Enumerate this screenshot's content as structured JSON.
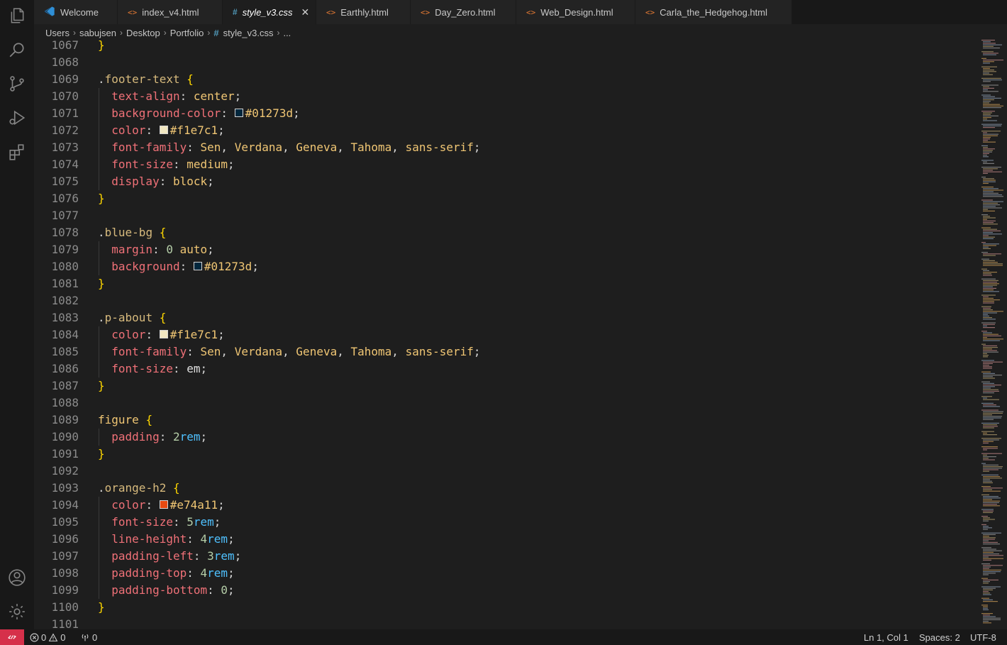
{
  "tabs": [
    {
      "label": "Welcome",
      "icon": "vscode-logo-icon"
    },
    {
      "label": "index_v4.html",
      "icon": "html-file-icon"
    },
    {
      "label": "style_v3.css",
      "icon": "css-file-icon",
      "active": true
    },
    {
      "label": "Earthly.html",
      "icon": "html-file-icon"
    },
    {
      "label": "Day_Zero.html",
      "icon": "html-file-icon"
    },
    {
      "label": "Web_Design.html",
      "icon": "html-file-icon"
    },
    {
      "label": "Carla_the_Hedgehog.html",
      "icon": "html-file-icon"
    }
  ],
  "tab_glyphs": {
    "html": "<>",
    "css": "#",
    "close": "✕"
  },
  "breadcrumb": {
    "items": [
      "Users",
      "sabujsen",
      "Desktop",
      "Portfolio"
    ],
    "file": "style_v3.css",
    "more": "...",
    "sep": "›",
    "hash": "#"
  },
  "colors": {
    "swatch_blue": "#01273d",
    "swatch_cream": "#f1e7c1",
    "swatch_orange": "#e74a11",
    "remote_accent": "#d6304a"
  },
  "code": {
    "lines": [
      {
        "n": "1067",
        "text": "}"
      },
      {
        "n": "1068",
        "text": ""
      },
      {
        "n": "1069",
        "text": ".footer-text {"
      },
      {
        "n": "1070",
        "text": "  text-align: center;"
      },
      {
        "n": "1071",
        "text": "  background-color: #01273d;"
      },
      {
        "n": "1072",
        "text": "  color: #f1e7c1;"
      },
      {
        "n": "1073",
        "text": "  font-family: Sen, Verdana, Geneva, Tahoma, sans-serif;"
      },
      {
        "n": "1074",
        "text": "  font-size: medium;"
      },
      {
        "n": "1075",
        "text": "  display: block;"
      },
      {
        "n": "1076",
        "text": "}"
      },
      {
        "n": "1077",
        "text": ""
      },
      {
        "n": "1078",
        "text": ".blue-bg {"
      },
      {
        "n": "1079",
        "text": "  margin: 0 auto;"
      },
      {
        "n": "1080",
        "text": "  background: #01273d;"
      },
      {
        "n": "1081",
        "text": "}"
      },
      {
        "n": "1082",
        "text": ""
      },
      {
        "n": "1083",
        "text": ".p-about {"
      },
      {
        "n": "1084",
        "text": "  color: #f1e7c1;"
      },
      {
        "n": "1085",
        "text": "  font-family: Sen, Verdana, Geneva, Tahoma, sans-serif;"
      },
      {
        "n": "1086",
        "text": "  font-size: em;"
      },
      {
        "n": "1087",
        "text": "}"
      },
      {
        "n": "1088",
        "text": ""
      },
      {
        "n": "1089",
        "text": "figure {"
      },
      {
        "n": "1090",
        "text": "  padding: 2rem;"
      },
      {
        "n": "1091",
        "text": "}"
      },
      {
        "n": "1092",
        "text": ""
      },
      {
        "n": "1093",
        "text": ".orange-h2 {"
      },
      {
        "n": "1094",
        "text": "  color: #e74a11;"
      },
      {
        "n": "1095",
        "text": "  font-size: 5rem;"
      },
      {
        "n": "1096",
        "text": "  line-height: 4rem;"
      },
      {
        "n": "1097",
        "text": "  padding-left: 3rem;"
      },
      {
        "n": "1098",
        "text": "  padding-top: 4rem;"
      },
      {
        "n": "1099",
        "text": "  padding-bottom: 0;"
      },
      {
        "n": "1100",
        "text": "}"
      },
      {
        "n": "1101",
        "text": ""
      }
    ]
  },
  "status": {
    "errors": "0",
    "warnings": "0",
    "ports": "0",
    "cursor": "Ln 1, Col 1",
    "spaces": "Spaces: 2",
    "encoding": "UTF-8"
  }
}
